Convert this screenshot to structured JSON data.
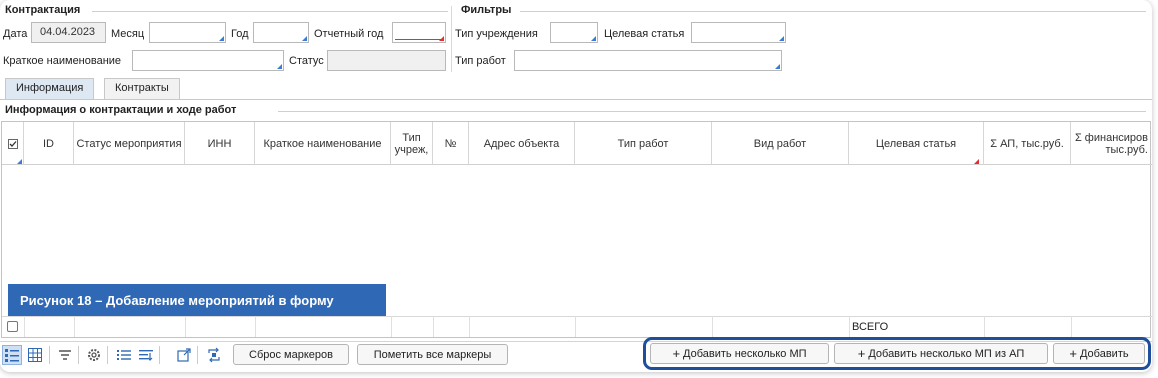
{
  "contracting": {
    "title": "Контрактация",
    "date_label": "Дата",
    "date_value": "04.04.2023",
    "month_label": "Месяц",
    "year_label": "Год",
    "report_year_label": "Отчетный год",
    "short_name_label": "Краткое наименование",
    "status_label": "Статус"
  },
  "filters": {
    "title": "Фильтры",
    "institution_type_label": "Тип учреждения",
    "target_article_label": "Целевая статья",
    "work_type_label": "Тип работ"
  },
  "tabs": [
    {
      "label": "Информация",
      "active": true
    },
    {
      "label": "Контракты",
      "active": false
    }
  ],
  "section": {
    "title": "Информация о контрактации и ходе работ"
  },
  "table": {
    "columns": [
      "ID",
      "Статус мероприятия",
      "ИНН",
      "Краткое наименование",
      "Тип учреж,",
      "№",
      "Адрес объекта",
      "Тип работ",
      "Вид работ",
      "Целевая статья",
      "Σ АП, тыс.руб.",
      "Σ финансиров тыс.руб."
    ],
    "rows": [],
    "total_label": "ВСЕГО"
  },
  "caption": "Рисунок 18 – Добавление мероприятий в форму",
  "toolbar": {
    "icons": [
      "list-view-icon",
      "grid-view-icon",
      "filter-icon",
      "settings-gear-icon",
      "ordered-list-icon",
      "column-list-icon",
      "export-icon",
      "refresh-icon"
    ],
    "reset_markers_label": "Сброс маркеров",
    "mark_all_label": "Пометить все маркеры",
    "add_several_label": "Добавить несколько МП",
    "add_several_from_ap_label": "Добавить несколько МП из АП",
    "add_label": "Добавить"
  },
  "colors": {
    "accent_blue": "#2f68b4",
    "highlight_border": "#1f4f9a",
    "required_red": "#e03030",
    "active_tab": "#dde8f3"
  }
}
